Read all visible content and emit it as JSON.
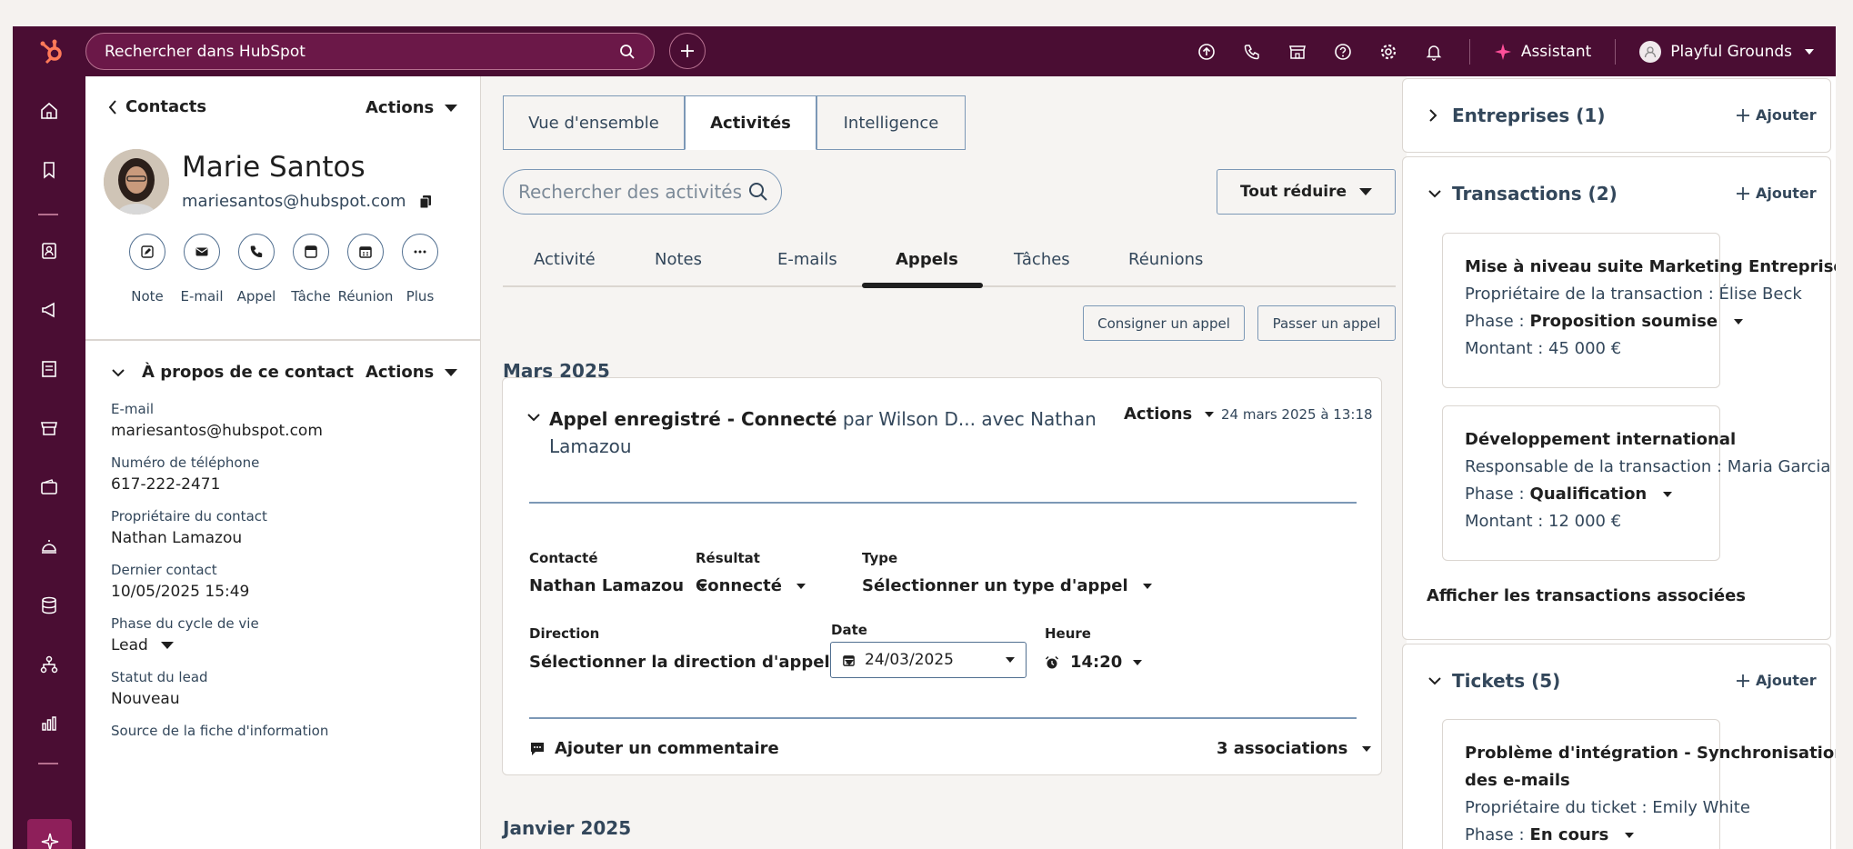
{
  "topbar": {
    "search_placeholder": "Rechercher dans HubSpot",
    "assistant_label": "Assistant",
    "account_name": "Playful Grounds",
    "brand_color": "#4a0d33"
  },
  "contact": {
    "back_label": "Contacts",
    "actions_label": "Actions",
    "name": "Marie Santos",
    "email": "mariesantos@hubspot.com",
    "quick_actions": [
      "Note",
      "E-mail",
      "Appel",
      "Tâche",
      "Réunion",
      "Plus"
    ],
    "about_title": "À propos de ce contact",
    "about_actions": "Actions",
    "fields": [
      {
        "label": "E-mail",
        "value": "mariesantos@hubspot.com"
      },
      {
        "label": "Numéro de téléphone",
        "value": "617-222-2471"
      },
      {
        "label": "Propriétaire du contact",
        "value": "Nathan Lamazou"
      },
      {
        "label": "Dernier contact",
        "value": "10/05/2025 15:49"
      },
      {
        "label": "Phase du cycle de vie",
        "value": "Lead"
      },
      {
        "label": "Statut du lead",
        "value": "Nouveau"
      }
    ],
    "cut_label": "Source de la fiche d'information"
  },
  "middle": {
    "tabs": [
      "Vue d'ensemble",
      "Activités",
      "Intelligence"
    ],
    "active_tab": "Activités",
    "search_placeholder": "Rechercher des activités",
    "collapse_label": "Tout réduire",
    "subtabs": [
      "Activité",
      "Notes",
      "E-mails",
      "Appels",
      "Tâches",
      "Réunions"
    ],
    "active_subtab": "Appels",
    "log_call": "Consigner un appel",
    "make_call": "Passer un appel",
    "month_1": "Mars 2025",
    "month_2": "Janvier 2025",
    "call": {
      "title_bold": "Appel enregistré - Connecté",
      "title_rest_1": "par Wilson D... avec Nathan",
      "title_rest_2": "Lamazou",
      "actions": "Actions",
      "timestamp": "24 mars 2025 à 13:18",
      "contacted_label": "Contacté",
      "contacted_value": "Nathan Lamazou",
      "result_label": "Résultat",
      "result_value": "Connecté",
      "type_label": "Type",
      "type_value": "Sélectionner un type d'appel",
      "direction_label": "Direction",
      "direction_value": "Sélectionner la direction d'appel",
      "date_label": "Date",
      "date_value": "24/03/2025",
      "time_label": "Heure",
      "time_value": "14:20",
      "comment": "Ajouter un commentaire",
      "associations": "3 associations"
    }
  },
  "right": {
    "add_label": "Ajouter",
    "companies_title": "Entreprises (1)",
    "deals_title": "Transactions (2)",
    "deals": [
      {
        "name": "Mise à niveau suite Marketing Entreprise",
        "owner": "Propriétaire de la transaction : Élise Beck",
        "phase_label": "Phase :",
        "phase_value": "Proposition soumise",
        "amount": "Montant : 45 000 €"
      },
      {
        "name": "Développement international",
        "owner": "Responsable de la transaction : Maria Garcia",
        "phase_label": "Phase :",
        "phase_value": "Qualification",
        "amount": "Montant : 12 000 €"
      }
    ],
    "show_deals": "Afficher les transactions associées",
    "tickets_title": "Tickets (5)",
    "ticket": {
      "name_1": "Problème d'intégration - Synchronisation",
      "name_2": "des e-mails",
      "owner": "Propriétaire du ticket : Emily White",
      "phase_label": "Phase :",
      "phase_value": "En cours"
    }
  }
}
